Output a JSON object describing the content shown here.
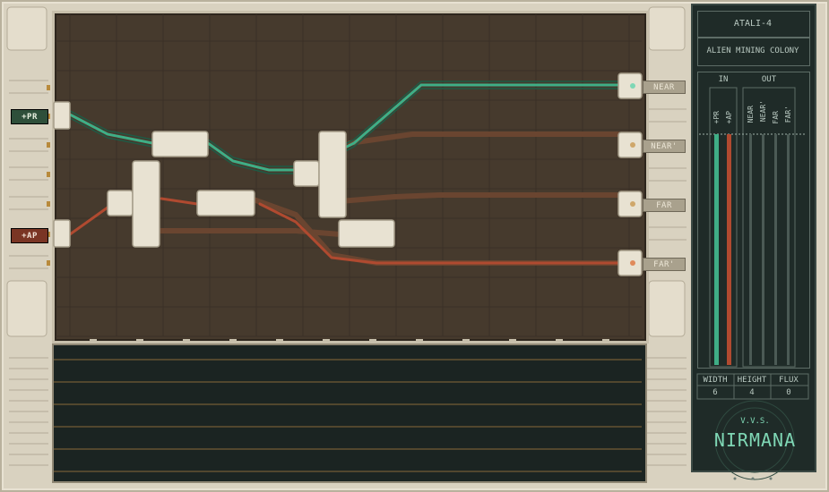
{
  "inputs": [
    {
      "label": "+PR",
      "color": "#2e4f3a",
      "text_color": "#e8f0e0"
    },
    {
      "label": "+AP",
      "color": "#7a3524",
      "text_color": "#f0e0d4"
    }
  ],
  "outputs": [
    {
      "label": "NEAR"
    },
    {
      "label": "NEAR'"
    },
    {
      "label": "FAR"
    },
    {
      "label": "FAR'"
    }
  ],
  "panel": {
    "title": "ATALI-4",
    "subtitle": "ALIEN MINING COLONY",
    "in_header": "IN",
    "out_header": "OUT",
    "in_channels": [
      "+PR",
      "+AP"
    ],
    "out_channels": [
      "NEAR",
      "NEAR'",
      "FAR",
      "FAR'"
    ],
    "stats": [
      {
        "label": "WIDTH",
        "value": "6"
      },
      {
        "label": "HEIGHT",
        "value": "4"
      },
      {
        "label": "FLUX",
        "value": "0"
      }
    ],
    "logo_top": "V.V.S.",
    "logo": "NIRMANA"
  },
  "colors": {
    "pr_wire": "#3fae86",
    "ap_wire": "#b04a30",
    "dark_wire": "#5a3a28",
    "board": "#463a2d",
    "grid": "#3a3026"
  }
}
